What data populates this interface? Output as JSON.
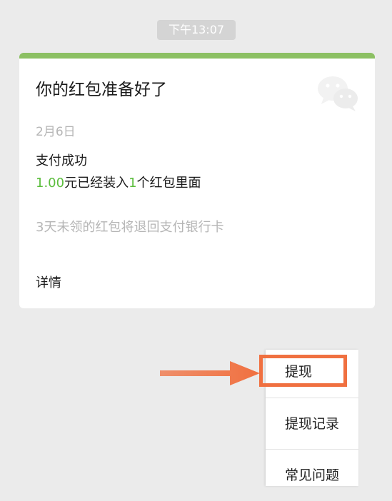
{
  "chat": {
    "timestamp": "下午13:07"
  },
  "card": {
    "title": "你的红包准备好了",
    "date": "2月6日",
    "pay_status": "支付成功",
    "amount": "1.00",
    "amount_mid_text": "元已经装入",
    "packet_count": "1",
    "amount_tail_text": "个红包里面",
    "return_note": "3天未领的红包将退回支付银行卡",
    "details_label": "详情",
    "icon": "wechat-logo-icon"
  },
  "menu": {
    "items": [
      {
        "label": "提现"
      },
      {
        "label": "提现记录"
      },
      {
        "label": "常见问题"
      }
    ]
  },
  "colors": {
    "background": "#ebebeb",
    "card_accent": "#8cc063",
    "amount_green": "#5bbd3c",
    "annotation_orange": "#f07040"
  }
}
